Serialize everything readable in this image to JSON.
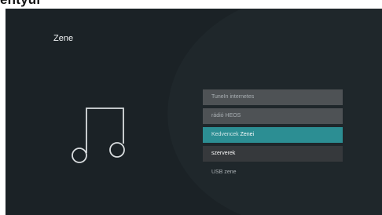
{
  "header_fragment": "entyül",
  "screen": {
    "title": "Zene",
    "icon": "music-note-icon",
    "menu": [
      {
        "label": "TuneIn internetes",
        "state": "normal"
      },
      {
        "label": "rádió HEOS",
        "state": "normal"
      },
      {
        "label_part1": "Kedvencek",
        "label_part2": "Zenei",
        "state": "selected"
      },
      {
        "label": "szerverek",
        "state": "dark"
      },
      {
        "label": "USB zene",
        "state": "plain"
      }
    ]
  },
  "colors": {
    "background": "#1b2226",
    "selected": "#2c8e93",
    "item": "#4e5255"
  }
}
